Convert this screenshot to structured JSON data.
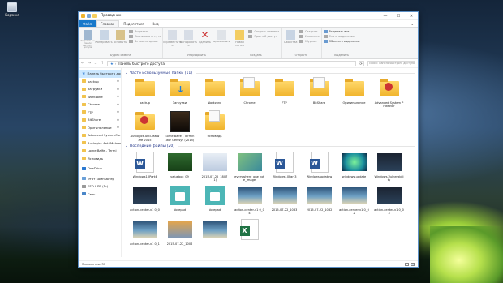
{
  "desktop": {
    "recycle_bin_label": "Корзина"
  },
  "window": {
    "title": "Проводник",
    "controls": {
      "minimize": "—",
      "maximize": "☐",
      "close": "✕"
    },
    "tabs": {
      "file": "Файл",
      "home": "Главная",
      "share": "Поделиться",
      "view": "Вид"
    },
    "ribbon": {
      "clipboard": {
        "pin": "Закрепить на панели быстрого доступа",
        "copy": "Копировать",
        "paste": "Вставить",
        "cut": "Вырезать",
        "copy_path": "Скопировать путь",
        "paste_shortcut": "Вставить ярлык",
        "group": "Буфер обмена"
      },
      "organize": {
        "move_to": "Переместить в",
        "copy_to": "Копировать в",
        "delete": "Удалить",
        "rename": "Переименовать",
        "group": "Упорядочить"
      },
      "new": {
        "new_folder": "Новая папка",
        "new_item": "Создать элемент",
        "easy_access": "Простой доступ",
        "group": "Создать"
      },
      "open": {
        "properties": "Свойства",
        "open": "Открыть",
        "edit": "Изменить",
        "history": "Журнал",
        "group": "Открыть"
      },
      "select": {
        "select_all": "Выделить все",
        "select_none": "Снять выделение",
        "invert": "Обратить выделение",
        "group": "Выделить"
      }
    },
    "address": {
      "path": "Панель быстрого доступа",
      "search_placeholder": "Поиск: Панель быстрого доступа"
    },
    "nav": [
      {
        "label": "Панель быстрого доступа",
        "type": "star",
        "selected": true
      },
      {
        "label": "backup",
        "type": "folder",
        "pin": "✱"
      },
      {
        "label": "Загрузки",
        "type": "folder",
        "pin": "✱"
      },
      {
        "label": "Workzone",
        "type": "folder",
        "pin": "✱"
      },
      {
        "label": "Chrome",
        "type": "folder",
        "pin": "✱"
      },
      {
        "label": "FTP",
        "type": "folder",
        "pin": "✱"
      },
      {
        "label": "BitShare",
        "type": "folder",
        "pin": "✱"
      },
      {
        "label": "Оригинальные",
        "type": "folder",
        "pin": "✱"
      },
      {
        "label": "Advanced SystemCare",
        "type": "folder",
        "pin": ""
      },
      {
        "label": "Auslogics Anti-Malware",
        "type": "folder",
        "pin": ""
      },
      {
        "label": "Lorne Balfe - Termi",
        "type": "folder",
        "pin": ""
      },
      {
        "label": "Ясновидь",
        "type": "folder",
        "pin": ""
      },
      {
        "label": "OneDrive",
        "type": "cloud",
        "pin": "",
        "gap": true
      },
      {
        "label": "Этот компьютер",
        "type": "pc",
        "pin": "",
        "gap": true
      },
      {
        "label": "ESD-USB (D:)",
        "type": "usb",
        "pin": ""
      },
      {
        "label": "Сеть",
        "type": "net",
        "pin": ""
      }
    ],
    "frequent": {
      "header": "Часто используемые папки (11)",
      "items": [
        {
          "name": "backup",
          "kind": "folder"
        },
        {
          "name": "Загрузки",
          "kind": "download"
        },
        {
          "name": "Workzone",
          "kind": "folder"
        },
        {
          "name": "Chrome",
          "kind": "folderdoc"
        },
        {
          "name": "FTP",
          "kind": "folder"
        },
        {
          "name": "BitShare",
          "kind": "folderdoc"
        },
        {
          "name": "Оригинальные",
          "kind": "folder"
        },
        {
          "name": "Advanced System Protector",
          "kind": "folderred"
        },
        {
          "name": "Auslogics Anti-Malware 2015",
          "kind": "folderred"
        },
        {
          "name": "Lorne Balfe - Terminator Genisys (2015)",
          "kind": "album"
        },
        {
          "name": "Ясновидь",
          "kind": "folderdoc"
        }
      ]
    },
    "recent": {
      "header": "Последние файлы (20)",
      "items": [
        {
          "name": "Windows10Part4",
          "kind": "word"
        },
        {
          "name": "valuebox_09",
          "kind": "pic-green"
        },
        {
          "name": "2015-07-22_1807 (1)",
          "kind": "pic-window"
        },
        {
          "name": "everywhere_one note_image",
          "kind": "pic-note"
        },
        {
          "name": "Windows10Part3",
          "kind": "word"
        },
        {
          "name": "Windowsupdatew",
          "kind": "word"
        },
        {
          "name": "windows-update",
          "kind": "pic-update"
        },
        {
          "name": "Windows-Vulnerability",
          "kind": "pic-dark"
        },
        {
          "name": "action-center-v1 0_0",
          "kind": "pic-dark"
        },
        {
          "name": "Notepad",
          "kind": "notepad"
        },
        {
          "name": "Notepad",
          "kind": "notepad"
        },
        {
          "name": "action-center-v1 0_04",
          "kind": "pic-land"
        },
        {
          "name": "2015-07-22_1033",
          "kind": "pic-land"
        },
        {
          "name": "2015-07-22_1032",
          "kind": "pic-land"
        },
        {
          "name": "action-center-v1 0_02",
          "kind": "pic-land"
        },
        {
          "name": "action-center-v1 0_03",
          "kind": "pic-dark"
        },
        {
          "name": "action-center-v1 0_1",
          "kind": "pic-land"
        },
        {
          "name": "2015-07-22_1006",
          "kind": "pic-sun"
        },
        {
          "name": "",
          "kind": "pic-land"
        },
        {
          "name": "",
          "kind": "excel"
        }
      ]
    },
    "status": "Элементов: 31"
  },
  "colors": {
    "accent": "#1979ca",
    "folder": "#f0b42c",
    "selection": "#cce8ff",
    "section_header": "#1e3287"
  }
}
